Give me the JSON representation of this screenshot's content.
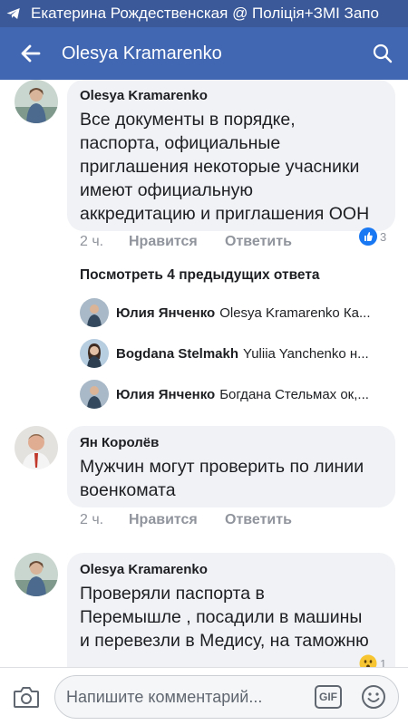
{
  "status_bar": {
    "notification": "Екатерина Рождественская @ Поліція+ЗМІ Запо"
  },
  "header": {
    "title": "Olesya Kramarenko"
  },
  "comments": [
    {
      "author": "Olesya Kramarenko",
      "lines": [
        "Все документы в порядке,",
        "паспорта, официальные",
        "приглашения некоторые учасники",
        "имеют официальную",
        "аккредитацию и приглашения ООН"
      ],
      "time": "2 ч.",
      "like_label": "Нравится",
      "reply_label": "Ответить",
      "reactions": "3"
    },
    {
      "author": "Ян Королёв",
      "lines": [
        "Мужчин могут проверить по линии",
        "военкомата"
      ],
      "time": "2 ч.",
      "like_label": "Нравится",
      "reply_label": "Ответить"
    },
    {
      "author": "Olesya Kramarenko",
      "lines": [
        "Проверяли паспорта в",
        "Перемышле , посадили в машины",
        "и перевезли в Медису, на таможню"
      ],
      "reactions": "1"
    }
  ],
  "previous_replies_label": "Посмотреть 4 предыдущих ответа",
  "replies": [
    {
      "author": "Юлия Янченко",
      "text": "Olesya Kramarenko Ка..."
    },
    {
      "author": "Bogdana Stelmakh",
      "text": "Yuliia Yanchenko н..."
    },
    {
      "author": "Юлия Янченко",
      "text": "Богдана Стельмах ок,..."
    }
  ],
  "composer": {
    "placeholder": "Напишите комментарий...",
    "gif_label": "GIF"
  },
  "icons": {
    "status": "telegram-icon",
    "back": "back-arrow-icon",
    "search": "search-icon",
    "like_reaction": "like-reaction-icon",
    "wow_reaction": "wow-reaction-icon",
    "camera": "camera-icon",
    "gif": "gif-icon",
    "emoji": "emoji-icon"
  },
  "colors": {
    "status_bar": "#3b5998",
    "header": "#4267b2",
    "bubble": "#f0f2f5",
    "like_blue": "#1877f2"
  }
}
